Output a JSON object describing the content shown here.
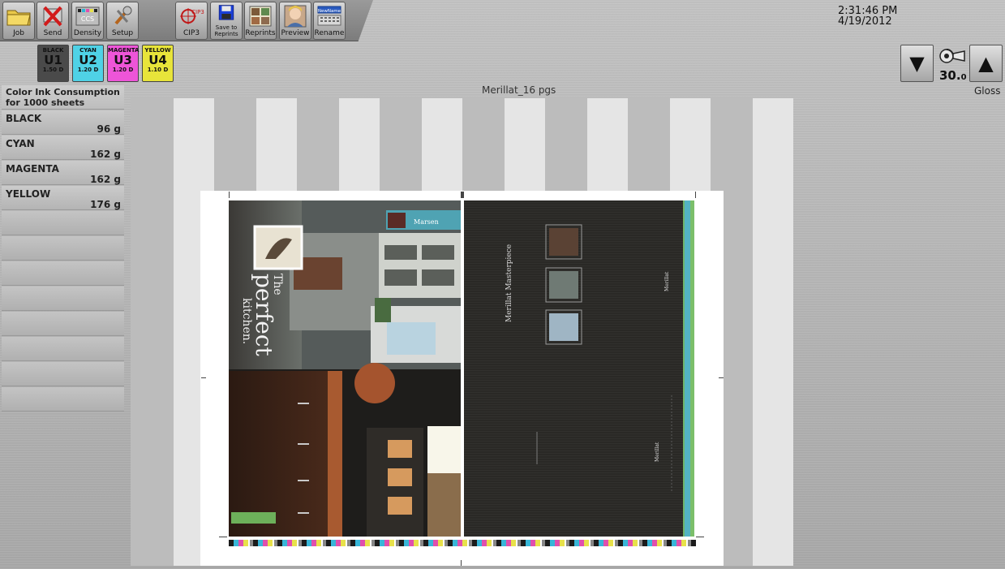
{
  "toolbar": {
    "buttons": [
      {
        "label": "Job"
      },
      {
        "label": "Send"
      },
      {
        "label": "Density"
      },
      {
        "label": "Setup"
      },
      {
        "label": "CIP3"
      },
      {
        "label": "Save to Reprints"
      },
      {
        "label": "Reprints"
      },
      {
        "label": "Preview"
      },
      {
        "label": "Rename"
      }
    ]
  },
  "clock": {
    "time": "2:31:46 PM",
    "date": "4/19/2012"
  },
  "units": [
    {
      "name": "BLACK",
      "unit": "U1",
      "density": "1.50 D",
      "color": "#4a4a4a"
    },
    {
      "name": "CYAN",
      "unit": "U2",
      "density": "1.20 D",
      "color": "#4fd2e6"
    },
    {
      "name": "MAGENTA",
      "unit": "U3",
      "density": "1.20 D",
      "color": "#ee55d8"
    },
    {
      "name": "YELLOW",
      "unit": "U4",
      "density": "1.10 D",
      "color": "#e8e43a"
    }
  ],
  "gloss": {
    "value": "30.",
    "decimal": "0",
    "label": "Gloss"
  },
  "ink_panel": {
    "title": "Color Ink Consumption",
    "subtitle": "for 1000 sheets",
    "rows": [
      {
        "name": "BLACK",
        "value": "96 g"
      },
      {
        "name": "CYAN",
        "value": "162 g"
      },
      {
        "name": "MAGENTA",
        "value": "162 g"
      },
      {
        "name": "YELLOW",
        "value": "176 g"
      }
    ]
  },
  "preview": {
    "job_name": "Merillat_16 pgs",
    "left_page": {
      "tab_label": "Marsen",
      "headline_1": "The",
      "headline_2": "perfect",
      "headline_3": "kitchen."
    },
    "right_page": {
      "title": "Merillat Masterpiece",
      "brand": "Merillat"
    }
  }
}
